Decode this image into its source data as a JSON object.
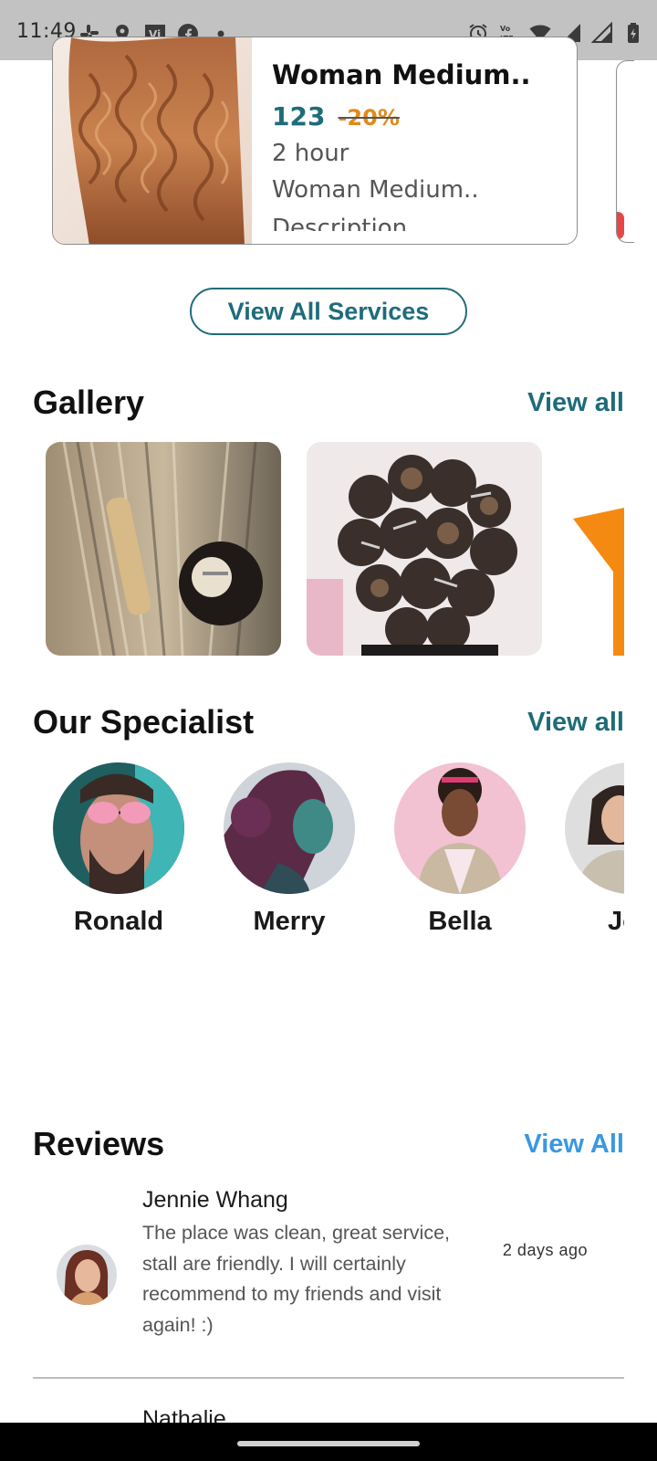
{
  "status_bar": {
    "time": "11:49",
    "left_icons": [
      "slack-icon",
      "location-pin-icon",
      "vi-app-icon",
      "facebook-icon",
      "dot-icon"
    ],
    "right_icons": [
      "alarm-icon",
      "volte-icon",
      "wifi-icon",
      "signal-icon",
      "signal-icon",
      "battery-icon"
    ]
  },
  "service_card": {
    "title": "Woman Medium..",
    "price": "123",
    "discount": "-20%",
    "duration": "2 hour",
    "description": "Woman Medium..",
    "description_more": "Description"
  },
  "view_all_services": "View All Services",
  "gallery": {
    "title": "Gallery",
    "view_all": "View all"
  },
  "specialists": {
    "title": "Our Specialist",
    "view_all": "View all",
    "names": [
      "Ronald",
      "Merry",
      "Bella",
      "Jos"
    ]
  },
  "reviews": {
    "title": "Reviews",
    "view_all": "View All",
    "items": [
      {
        "name": "Jennie Whang",
        "text": "The place was clean, great service, stall are friendly. I will certainly recommend to my friends and visit again! :)",
        "time": "2 days ago"
      },
      {
        "name": "Nathalie"
      }
    ]
  },
  "colors": {
    "accent": "#1f6c7a",
    "discount": "#e28a1a",
    "reviews_link": "#3a98e0",
    "status_bar": "#c2c2c2"
  }
}
